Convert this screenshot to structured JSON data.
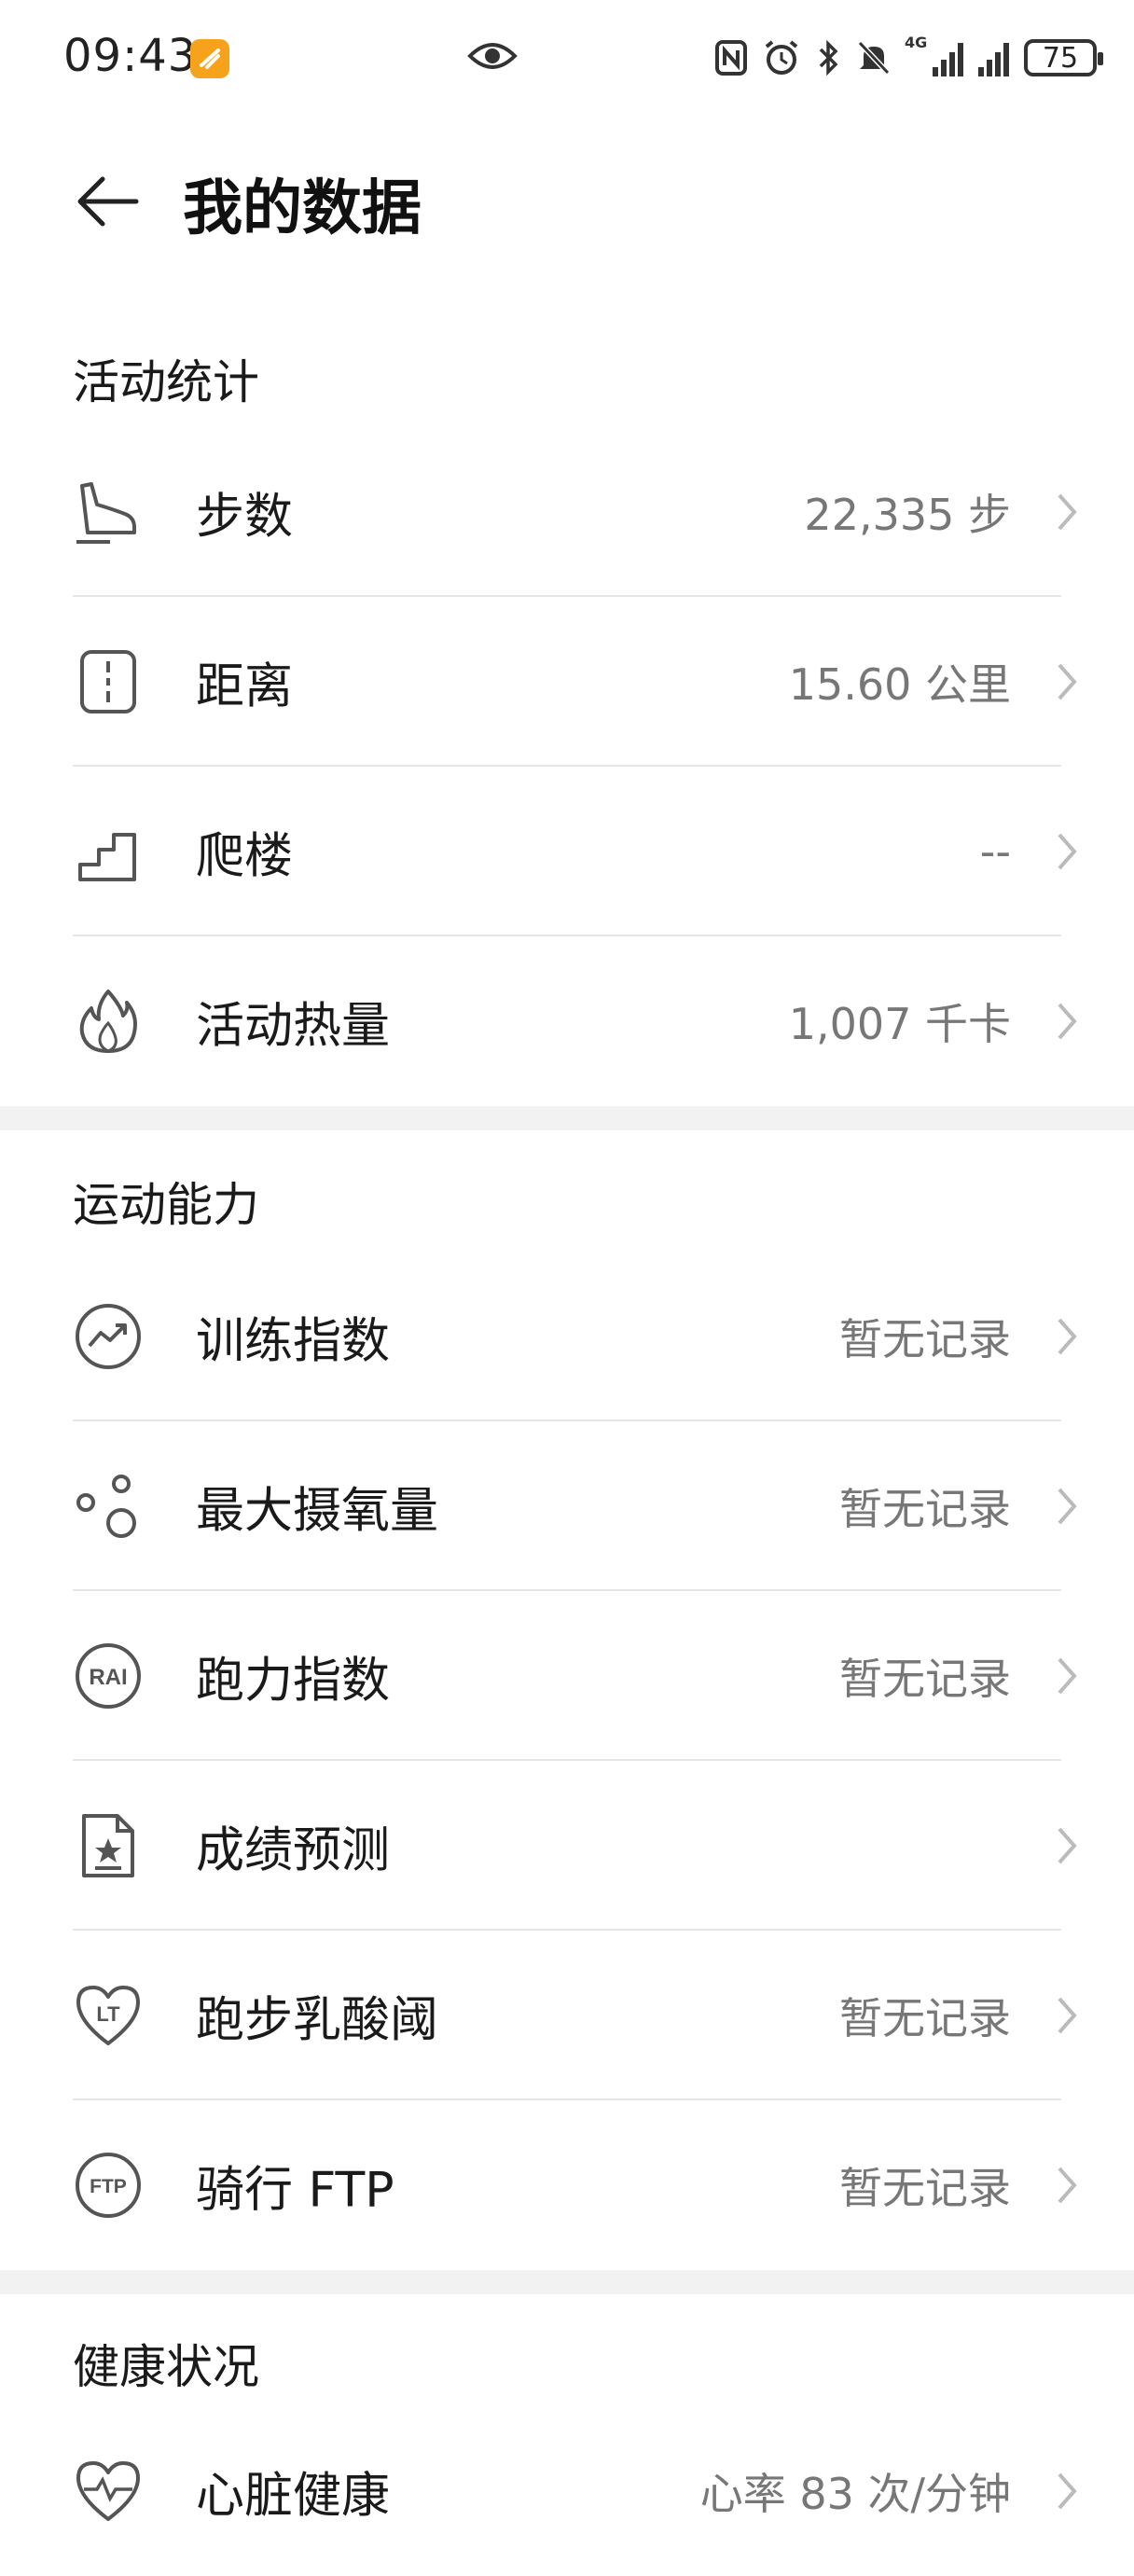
{
  "status_bar": {
    "time": "09:43",
    "battery": "75",
    "network": "4G"
  },
  "header": {
    "title": "我的数据"
  },
  "sections": [
    {
      "title": "活动统计",
      "items": [
        {
          "label": "步数",
          "value": "22,335 步",
          "icon": "shoe-icon"
        },
        {
          "label": "距离",
          "value": "15.60 公里",
          "icon": "distance-icon"
        },
        {
          "label": "爬楼",
          "value": "--",
          "icon": "stairs-icon"
        },
        {
          "label": "活动热量",
          "value": "1,007 千卡",
          "icon": "flame-icon"
        }
      ]
    },
    {
      "title": "运动能力",
      "items": [
        {
          "label": "训练指数",
          "value": "暂无记录",
          "icon": "trend-icon"
        },
        {
          "label": "最大摄氧量",
          "value": "暂无记录",
          "icon": "bubbles-icon"
        },
        {
          "label": "跑力指数",
          "value": "暂无记录",
          "icon": "rai-icon",
          "icon_text": "RAI"
        },
        {
          "label": "成绩预测",
          "value": "",
          "icon": "star-document-icon"
        },
        {
          "label": "跑步乳酸阈",
          "value": "暂无记录",
          "icon": "lt-heart-icon",
          "icon_text": "LT"
        },
        {
          "label": "骑行 FTP",
          "value": "暂无记录",
          "icon": "ftp-icon",
          "icon_text": "FTP"
        }
      ]
    },
    {
      "title": "健康状况",
      "items": [
        {
          "label": "心脏健康",
          "value": "心率 83 次/分钟",
          "icon": "heart-pulse-icon"
        }
      ]
    }
  ]
}
